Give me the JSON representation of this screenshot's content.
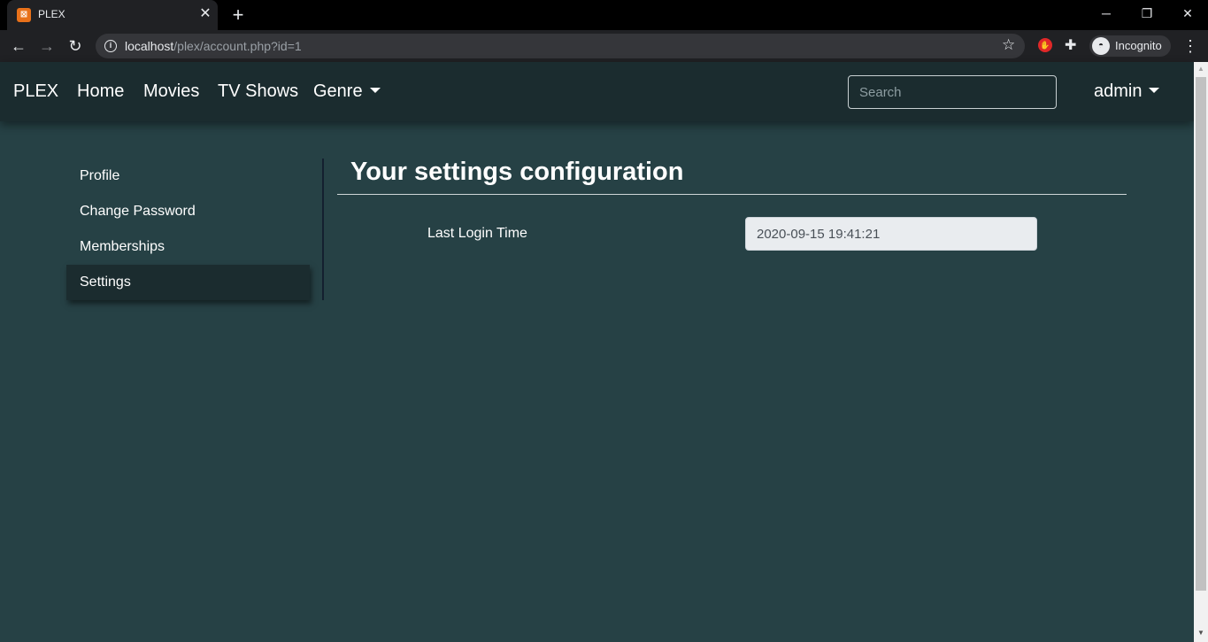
{
  "browser": {
    "tab_title": "PLEX",
    "tab_favicon_text": "⊠",
    "url_host": "localhost",
    "url_path": "/plex/account.php?id=1",
    "incognito_label": "Incognito",
    "favicon_color": "#e8711a"
  },
  "navbar": {
    "brand": "PLEX",
    "links": {
      "home": "Home",
      "movies": "Movies",
      "tv_shows": "TV Shows",
      "genre": "Genre"
    },
    "search_placeholder": "Search",
    "user": "admin"
  },
  "sidebar": {
    "items": [
      {
        "label": "Profile"
      },
      {
        "label": "Change Password"
      },
      {
        "label": "Memberships"
      },
      {
        "label": "Settings"
      }
    ],
    "active": "Settings"
  },
  "content": {
    "title": "Your settings configuration",
    "fields": [
      {
        "label": "Last Login Time",
        "value": "2020-09-15 19:41:21"
      }
    ]
  },
  "colors": {
    "page_bg": "#264145",
    "navbar_bg": "#1b2c2f",
    "active_item_bg": "#1b2c2f"
  }
}
